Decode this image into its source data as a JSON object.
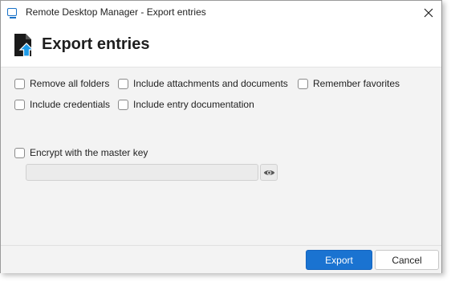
{
  "window": {
    "title": "Remote Desktop Manager - Export entries",
    "icon": "remote-desktop-icon",
    "close_icon": "close-icon"
  },
  "header": {
    "title": "Export entries",
    "icon": "export-document-icon",
    "icon_color": "#1a1a1a",
    "arrow_color": "#1e9be8"
  },
  "options": {
    "remove_all_folders": {
      "label": "Remove all folders",
      "checked": false
    },
    "include_attachments": {
      "label": "Include attachments and documents",
      "checked": false
    },
    "remember_favorites": {
      "label": "Remember favorites",
      "checked": false
    },
    "include_credentials": {
      "label": "Include credentials",
      "checked": false
    },
    "include_documentation": {
      "label": "Include entry documentation",
      "checked": false
    },
    "encrypt_master_key": {
      "label": "Encrypt with the master key",
      "checked": false
    }
  },
  "password": {
    "value": "",
    "show_icon": "eye-icon"
  },
  "footer": {
    "export_label": "Export",
    "cancel_label": "Cancel"
  },
  "colors": {
    "accent": "#1a73d1",
    "dialog_background": "#f3f3f3",
    "header_background": "#ffffff"
  }
}
